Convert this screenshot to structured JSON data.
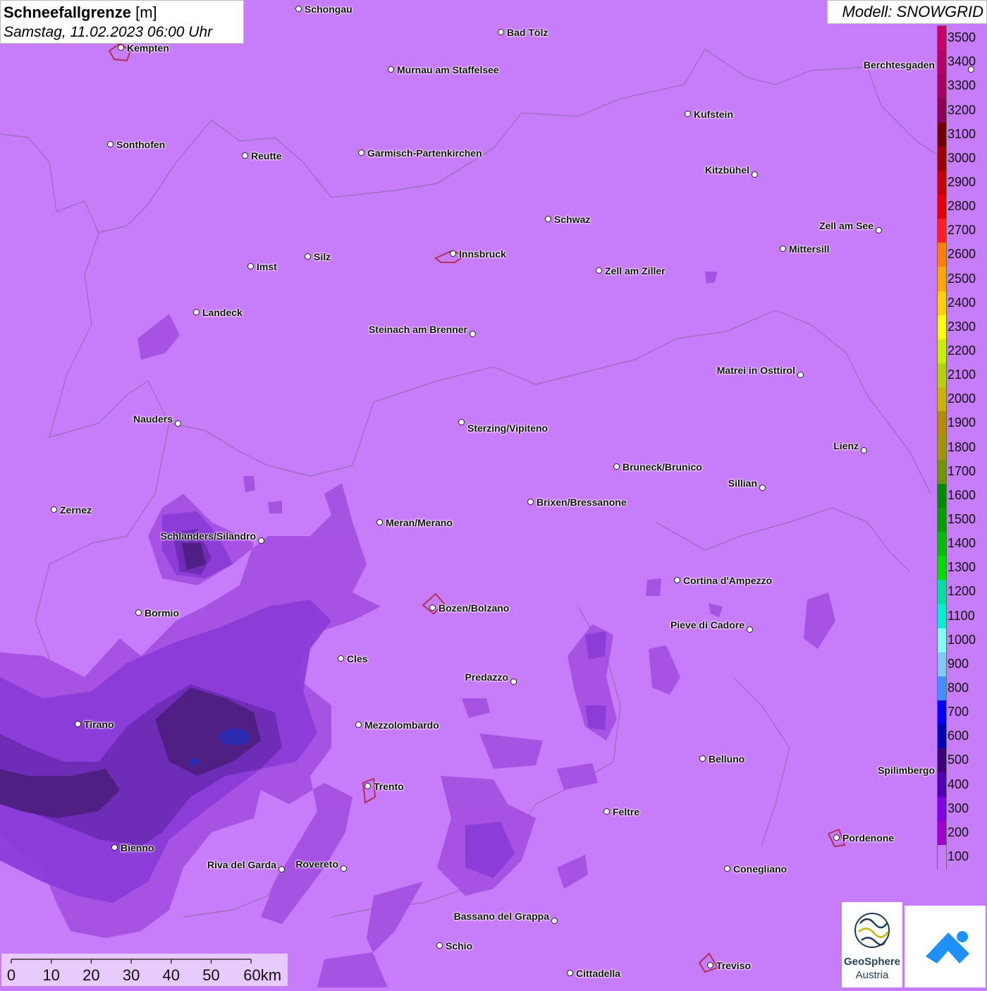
{
  "header": {
    "title_bold": "Schneefallgrenze",
    "title_unit": "[m]",
    "datetime": "Samstag, 11.02.2023 06:00 Uhr",
    "model": "Modell: SNOWGRID"
  },
  "legend": {
    "labels": [
      "3500",
      "3400",
      "3300",
      "3200",
      "3100",
      "3000",
      "2900",
      "2800",
      "2700",
      "2600",
      "2500",
      "2400",
      "2300",
      "2200",
      "2100",
      "2000",
      "1900",
      "1800",
      "1700",
      "1600",
      "1500",
      "1400",
      "1300",
      "1200",
      "1100",
      "1000",
      "900",
      "800",
      "700",
      "600",
      "500",
      "400",
      "300",
      "200",
      "100"
    ],
    "colors": [
      "#c8006e",
      "#b8006a",
      "#a50062",
      "#8e005a",
      "#6e0000",
      "#a00000",
      "#c80000",
      "#e60000",
      "#ff2020",
      "#ff8000",
      "#ffa500",
      "#ffd000",
      "#ffff00",
      "#c8f000",
      "#b4d200",
      "#c8b400",
      "#b48c00",
      "#a09600",
      "#6e9600",
      "#008c00",
      "#00a000",
      "#00be00",
      "#00dc00",
      "#00e0a0",
      "#00f0d0",
      "#80ffff",
      "#80c8ff",
      "#4090ff",
      "#0000ff",
      "#0000b4",
      "#3c0078",
      "#5000b4",
      "#8200e6",
      "#a000c8",
      "#c77cf9"
    ]
  },
  "cities": [
    {
      "name": "Schongau"
    },
    {
      "name": "Bad Tölz"
    },
    {
      "name": "Kempten"
    },
    {
      "name": "Murnau am Staffelsee"
    },
    {
      "name": "Berchtesgaden"
    },
    {
      "name": "Kufstein"
    },
    {
      "name": "Sonthofen"
    },
    {
      "name": "Reutte"
    },
    {
      "name": "Garmisch-Partenkirchen"
    },
    {
      "name": "Kitzbühel"
    },
    {
      "name": "Schwaz"
    },
    {
      "name": "Zell am See"
    },
    {
      "name": "Mittersill"
    },
    {
      "name": "Innsbruck"
    },
    {
      "name": "Imst"
    },
    {
      "name": "Silz"
    },
    {
      "name": "Zell am Ziller"
    },
    {
      "name": "Landeck"
    },
    {
      "name": "Steinach am Brenner"
    },
    {
      "name": "Matrei in Osttirol"
    },
    {
      "name": "Nauders"
    },
    {
      "name": "Sterzing/Vipiteno"
    },
    {
      "name": "Lienz"
    },
    {
      "name": "Bruneck/Brunico"
    },
    {
      "name": "Sillian"
    },
    {
      "name": "Zernez"
    },
    {
      "name": "Brixen/Bressanone"
    },
    {
      "name": "Meran/Merano"
    },
    {
      "name": "Schlanders/Silandro"
    },
    {
      "name": "Cortina d'Ampezzo"
    },
    {
      "name": "Bormio"
    },
    {
      "name": "Bozen/Bolzano"
    },
    {
      "name": "Pieve di Cadore"
    },
    {
      "name": "Cles"
    },
    {
      "name": "Predazzo"
    },
    {
      "name": "Tirano"
    },
    {
      "name": "Mezzolombardo"
    },
    {
      "name": "Belluno"
    },
    {
      "name": "Spilimbergo"
    },
    {
      "name": "Trento"
    },
    {
      "name": "Feltre"
    },
    {
      "name": "Pordenone"
    },
    {
      "name": "Bienno"
    },
    {
      "name": "Riva del Garda"
    },
    {
      "name": "Rovereto"
    },
    {
      "name": "Conegliano"
    },
    {
      "name": "Bassano del Grappa"
    },
    {
      "name": "Schio"
    },
    {
      "name": "Treviso"
    },
    {
      "name": "Cittadella"
    }
  ],
  "scale": {
    "labels": [
      "0",
      "10",
      "20",
      "30",
      "40",
      "50",
      "60km"
    ]
  },
  "logos": {
    "geosphere_line1": "GeoSphere",
    "geosphere_line2": "Austria"
  },
  "colors": {
    "background": "#c77cf9",
    "band_200": "#a34ee0",
    "band_300": "#8f38d8",
    "band_400": "#7a2bc9",
    "band_500": "#4a1d7a",
    "band_600": "#2a2ab0"
  }
}
